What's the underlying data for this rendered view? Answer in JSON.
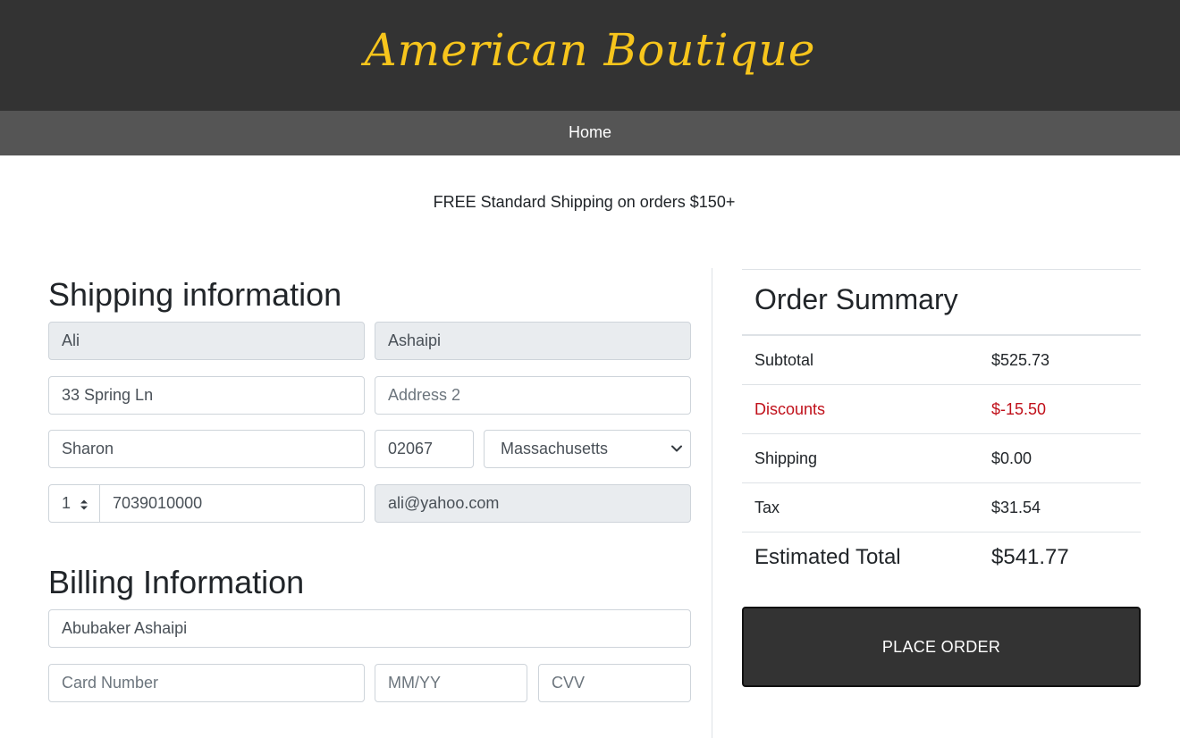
{
  "header": {
    "brand": "American Boutique"
  },
  "nav": {
    "home": "Home"
  },
  "promo": {
    "text": "FREE Standard Shipping on orders $150+"
  },
  "shipping": {
    "title": "Shipping information",
    "first_name": "Ali",
    "last_name": "Ashaipi",
    "address1": "33 Spring Ln",
    "address2_placeholder": "Address 2",
    "city": "Sharon",
    "zip": "02067",
    "state": "Massachusetts",
    "country_code": "1",
    "phone": "7039010000",
    "email": "ali@yahoo.com"
  },
  "billing": {
    "title": "Billing Information",
    "name_on_card": "Abubaker Ashaipi",
    "card_number_placeholder": "Card Number",
    "expiry_placeholder": "MM/YY",
    "cvv_placeholder": "CVV"
  },
  "summary": {
    "title": "Order Summary",
    "subtotal_label": "Subtotal",
    "subtotal_value": "$525.73",
    "discounts_label": "Discounts",
    "discounts_value": "$-15.50",
    "shipping_label": "Shipping",
    "shipping_value": "$0.00",
    "tax_label": "Tax",
    "tax_value": "$31.54",
    "total_label": "Estimated Total",
    "total_value": "$541.77"
  },
  "actions": {
    "place_order": "PLACE ORDER"
  },
  "colors": {
    "brand": "#f7c51c",
    "header_bg": "#333333",
    "nav_bg": "#555555",
    "discount": "#c0101a",
    "button_bg": "#333333"
  },
  "icons": {
    "select_chevron": "chevron-down-icon",
    "stepper": "up-down-arrows-icon"
  }
}
